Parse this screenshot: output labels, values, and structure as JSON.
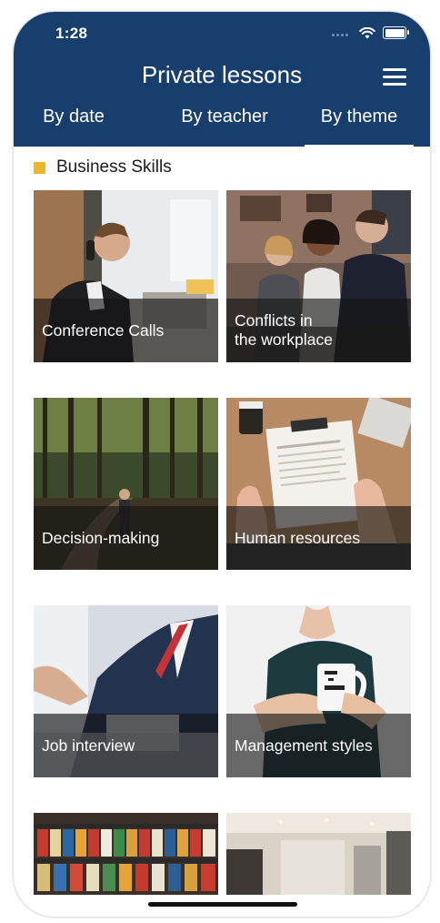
{
  "status": {
    "time": "1:28"
  },
  "header": {
    "title": "Private lessons",
    "menu_icon": "hamburger-menu-icon"
  },
  "tabs": [
    {
      "label": "By date",
      "active": false
    },
    {
      "label": "By teacher",
      "active": false
    },
    {
      "label": "By theme",
      "active": true
    }
  ],
  "section": {
    "label": "Business Skills",
    "accent": "#f1b52a"
  },
  "colors": {
    "header_bg": "#183e6e",
    "accent": "#f1b52a"
  },
  "cards": [
    {
      "title": "Conference Calls"
    },
    {
      "title": "Conflicts in\nthe workplace"
    },
    {
      "title": "Decision-making"
    },
    {
      "title": "Human resources"
    },
    {
      "title": "Job interview"
    },
    {
      "title": "Management styles"
    }
  ]
}
